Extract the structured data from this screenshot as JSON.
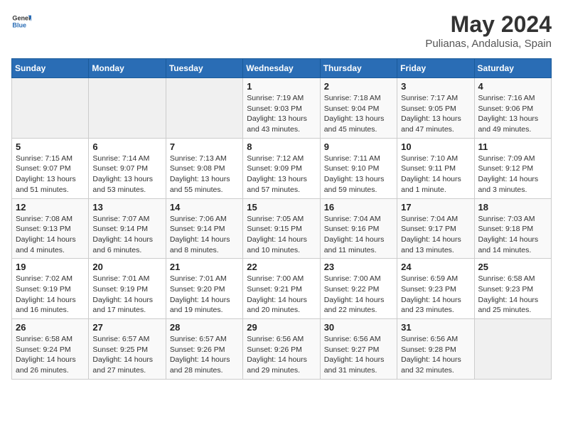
{
  "header": {
    "logo_general": "General",
    "logo_blue": "Blue",
    "month_year": "May 2024",
    "location": "Pulianas, Andalusia, Spain"
  },
  "days_of_week": [
    "Sunday",
    "Monday",
    "Tuesday",
    "Wednesday",
    "Thursday",
    "Friday",
    "Saturday"
  ],
  "weeks": [
    [
      {
        "day": "",
        "info": ""
      },
      {
        "day": "",
        "info": ""
      },
      {
        "day": "",
        "info": ""
      },
      {
        "day": "1",
        "info": "Sunrise: 7:19 AM\nSunset: 9:03 PM\nDaylight: 13 hours\nand 43 minutes."
      },
      {
        "day": "2",
        "info": "Sunrise: 7:18 AM\nSunset: 9:04 PM\nDaylight: 13 hours\nand 45 minutes."
      },
      {
        "day": "3",
        "info": "Sunrise: 7:17 AM\nSunset: 9:05 PM\nDaylight: 13 hours\nand 47 minutes."
      },
      {
        "day": "4",
        "info": "Sunrise: 7:16 AM\nSunset: 9:06 PM\nDaylight: 13 hours\nand 49 minutes."
      }
    ],
    [
      {
        "day": "5",
        "info": "Sunrise: 7:15 AM\nSunset: 9:07 PM\nDaylight: 13 hours\nand 51 minutes."
      },
      {
        "day": "6",
        "info": "Sunrise: 7:14 AM\nSunset: 9:07 PM\nDaylight: 13 hours\nand 53 minutes."
      },
      {
        "day": "7",
        "info": "Sunrise: 7:13 AM\nSunset: 9:08 PM\nDaylight: 13 hours\nand 55 minutes."
      },
      {
        "day": "8",
        "info": "Sunrise: 7:12 AM\nSunset: 9:09 PM\nDaylight: 13 hours\nand 57 minutes."
      },
      {
        "day": "9",
        "info": "Sunrise: 7:11 AM\nSunset: 9:10 PM\nDaylight: 13 hours\nand 59 minutes."
      },
      {
        "day": "10",
        "info": "Sunrise: 7:10 AM\nSunset: 9:11 PM\nDaylight: 14 hours\nand 1 minute."
      },
      {
        "day": "11",
        "info": "Sunrise: 7:09 AM\nSunset: 9:12 PM\nDaylight: 14 hours\nand 3 minutes."
      }
    ],
    [
      {
        "day": "12",
        "info": "Sunrise: 7:08 AM\nSunset: 9:13 PM\nDaylight: 14 hours\nand 4 minutes."
      },
      {
        "day": "13",
        "info": "Sunrise: 7:07 AM\nSunset: 9:14 PM\nDaylight: 14 hours\nand 6 minutes."
      },
      {
        "day": "14",
        "info": "Sunrise: 7:06 AM\nSunset: 9:14 PM\nDaylight: 14 hours\nand 8 minutes."
      },
      {
        "day": "15",
        "info": "Sunrise: 7:05 AM\nSunset: 9:15 PM\nDaylight: 14 hours\nand 10 minutes."
      },
      {
        "day": "16",
        "info": "Sunrise: 7:04 AM\nSunset: 9:16 PM\nDaylight: 14 hours\nand 11 minutes."
      },
      {
        "day": "17",
        "info": "Sunrise: 7:04 AM\nSunset: 9:17 PM\nDaylight: 14 hours\nand 13 minutes."
      },
      {
        "day": "18",
        "info": "Sunrise: 7:03 AM\nSunset: 9:18 PM\nDaylight: 14 hours\nand 14 minutes."
      }
    ],
    [
      {
        "day": "19",
        "info": "Sunrise: 7:02 AM\nSunset: 9:19 PM\nDaylight: 14 hours\nand 16 minutes."
      },
      {
        "day": "20",
        "info": "Sunrise: 7:01 AM\nSunset: 9:19 PM\nDaylight: 14 hours\nand 17 minutes."
      },
      {
        "day": "21",
        "info": "Sunrise: 7:01 AM\nSunset: 9:20 PM\nDaylight: 14 hours\nand 19 minutes."
      },
      {
        "day": "22",
        "info": "Sunrise: 7:00 AM\nSunset: 9:21 PM\nDaylight: 14 hours\nand 20 minutes."
      },
      {
        "day": "23",
        "info": "Sunrise: 7:00 AM\nSunset: 9:22 PM\nDaylight: 14 hours\nand 22 minutes."
      },
      {
        "day": "24",
        "info": "Sunrise: 6:59 AM\nSunset: 9:23 PM\nDaylight: 14 hours\nand 23 minutes."
      },
      {
        "day": "25",
        "info": "Sunrise: 6:58 AM\nSunset: 9:23 PM\nDaylight: 14 hours\nand 25 minutes."
      }
    ],
    [
      {
        "day": "26",
        "info": "Sunrise: 6:58 AM\nSunset: 9:24 PM\nDaylight: 14 hours\nand 26 minutes."
      },
      {
        "day": "27",
        "info": "Sunrise: 6:57 AM\nSunset: 9:25 PM\nDaylight: 14 hours\nand 27 minutes."
      },
      {
        "day": "28",
        "info": "Sunrise: 6:57 AM\nSunset: 9:26 PM\nDaylight: 14 hours\nand 28 minutes."
      },
      {
        "day": "29",
        "info": "Sunrise: 6:56 AM\nSunset: 9:26 PM\nDaylight: 14 hours\nand 29 minutes."
      },
      {
        "day": "30",
        "info": "Sunrise: 6:56 AM\nSunset: 9:27 PM\nDaylight: 14 hours\nand 31 minutes."
      },
      {
        "day": "31",
        "info": "Sunrise: 6:56 AM\nSunset: 9:28 PM\nDaylight: 14 hours\nand 32 minutes."
      },
      {
        "day": "",
        "info": ""
      }
    ]
  ]
}
